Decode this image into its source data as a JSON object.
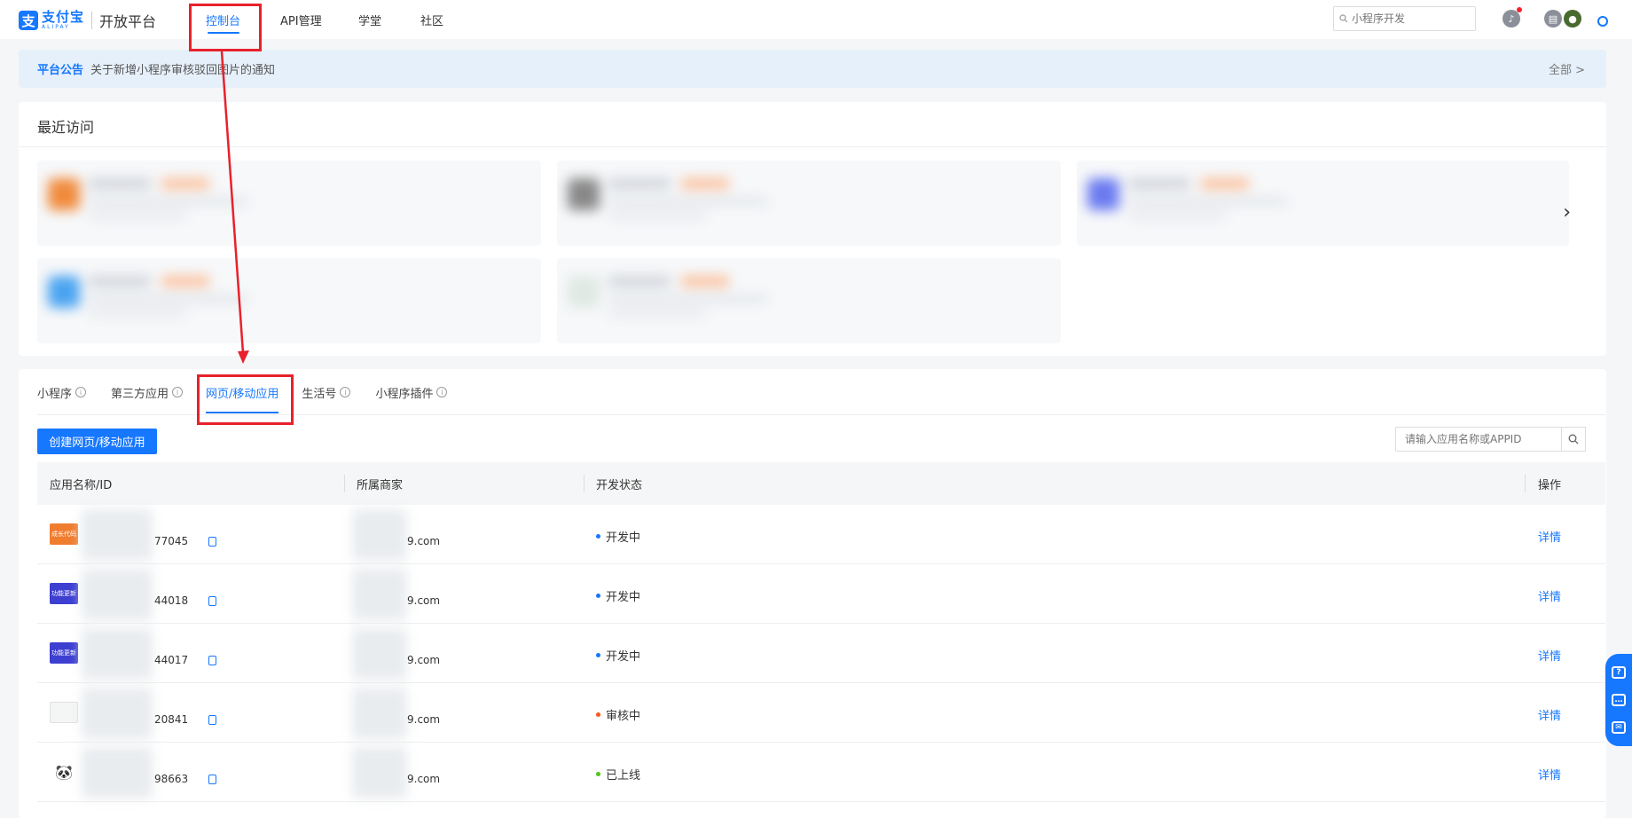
{
  "header": {
    "logo_mark": "支",
    "logo_cn": "支付宝",
    "logo_en": "ALIPAY",
    "platform_title": "开放平台",
    "nav": [
      "控制台",
      "API管理",
      "学堂",
      "社区"
    ],
    "search_placeholder": "小程序开发"
  },
  "notice": {
    "tag": "平台公告",
    "text": "关于新增小程序审核驳回图片的通知",
    "all_label": "全部 >"
  },
  "recent": {
    "title": "最近访问"
  },
  "apps_panel": {
    "tabs": [
      "小程序",
      "第三方应用",
      "网页/移动应用",
      "生活号",
      "小程序插件"
    ],
    "active_tab": "网页/移动应用",
    "create_button": "创建网页/移动应用",
    "search_placeholder": "请输入应用名称或APPID",
    "columns": [
      "应用名称/ID",
      "所属商家",
      "开发状态",
      "操作"
    ],
    "rows": [
      {
        "id_suffix": "77045",
        "merchant_suffix": "9.com",
        "status": "开发中",
        "status_color": "#1677ff",
        "action": "详情",
        "thumb_text": "成长代码"
      },
      {
        "id_suffix": "44018",
        "merchant_suffix": "9.com",
        "status": "开发中",
        "status_color": "#1677ff",
        "action": "详情",
        "thumb_text": "功能更新"
      },
      {
        "id_suffix": "44017",
        "merchant_suffix": "9.com",
        "status": "开发中",
        "status_color": "#1677ff",
        "action": "详情",
        "thumb_text": "功能更新"
      },
      {
        "id_suffix": "20841",
        "merchant_suffix": "9.com",
        "status": "审核中",
        "status_color": "#fa541c",
        "action": "详情",
        "thumb_text": ""
      },
      {
        "id_suffix": "98663",
        "merchant_suffix": "9.com",
        "status": "已上线",
        "status_color": "#52c41a",
        "action": "详情",
        "thumb_text": "🐼"
      }
    ]
  },
  "colors": {
    "accent": "#1677ff",
    "highlight": "#e8212b"
  }
}
